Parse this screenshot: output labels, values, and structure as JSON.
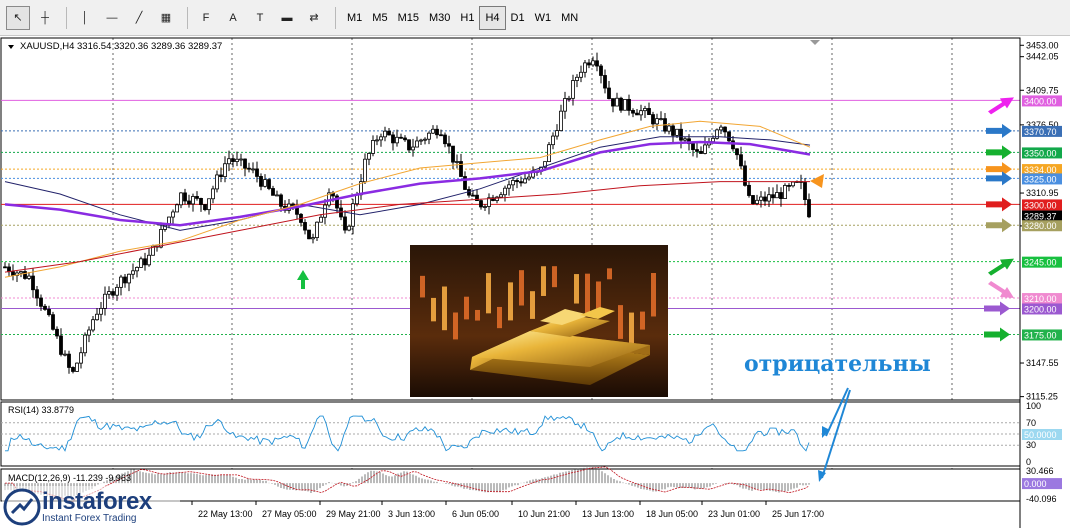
{
  "toolbar": {
    "tools": [
      {
        "name": "cursor-tool",
        "glyph": "↖"
      },
      {
        "name": "crosshair-tool",
        "glyph": "┼"
      },
      {
        "name": "vertical-line-tool",
        "glyph": "│"
      },
      {
        "name": "horizontal-line-tool",
        "glyph": "—"
      },
      {
        "name": "trendline-tool",
        "glyph": "╱"
      },
      {
        "name": "channel-tool",
        "glyph": "▦"
      },
      {
        "name": "fibonacci-tool",
        "glyph": "F"
      },
      {
        "name": "text-tool",
        "glyph": "A"
      },
      {
        "name": "text-label-tool",
        "glyph": "T"
      },
      {
        "name": "rectangle-tool",
        "glyph": "▬"
      },
      {
        "name": "arrows-tool",
        "glyph": "⇄"
      }
    ],
    "timeframes": [
      "M1",
      "M5",
      "M15",
      "M30",
      "H1",
      "H4",
      "D1",
      "W1",
      "MN"
    ],
    "active_timeframe": "H4"
  },
  "header": {
    "symbol": "XAUUSD,H4",
    "ohlc": "3316.54 3320.36 3289.36 3289.37"
  },
  "rsi": {
    "label": "RSI(14) 33.8779",
    "levels": [
      "100",
      "70",
      "50.0000",
      "30",
      "0"
    ]
  },
  "macd": {
    "label": "MACD(12,26,9) -11.239 -9.963",
    "levels": [
      "30.466",
      "0.000",
      "-40.096"
    ]
  },
  "price_axis": {
    "ticks": [
      "3453.00",
      "3442.05",
      "3409.75",
      "3376.50",
      "3310.95",
      "3279.35",
      "3147.55",
      "3115.25"
    ]
  },
  "price_tags": [
    {
      "text": "3400.00",
      "value": 3400,
      "bg": "#e060e0",
      "fg": "#ffffff"
    },
    {
      "text": "3370.70",
      "value": 3370.7,
      "bg": "#3a6fb5",
      "fg": "#ffffff"
    },
    {
      "text": "3350.00",
      "value": 3350,
      "bg": "#12a84a",
      "fg": "#ffffff"
    },
    {
      "text": "3334.00",
      "value": 3334,
      "bg": "#f5a623",
      "fg": "#ffffff"
    },
    {
      "text": "3325.00",
      "value": 3325,
      "bg": "#4a8fe0",
      "fg": "#ffffff"
    },
    {
      "text": "3300.00",
      "value": 3300,
      "bg": "#e01e1e",
      "fg": "#ffffff"
    },
    {
      "text": "3289.37",
      "value": 3289.37,
      "bg": "#000000",
      "fg": "#ffffff"
    },
    {
      "text": "3280.00",
      "value": 3280,
      "bg": "#a6a060",
      "fg": "#ffffff"
    },
    {
      "text": "3245.00",
      "value": 3245,
      "bg": "#18c040",
      "fg": "#ffffff"
    },
    {
      "text": "3210.00",
      "value": 3210,
      "bg": "#f08ad0",
      "fg": "#ffffff"
    },
    {
      "text": "3200.00",
      "value": 3200,
      "bg": "#9b59d0",
      "fg": "#ffffff"
    },
    {
      "text": "3175.00",
      "value": 3175,
      "bg": "#22b24c",
      "fg": "#ffffff"
    }
  ],
  "time_axis": [
    "22 May 13:00",
    "27 May 05:00",
    "29 May 21:00",
    "3 Jun 13:00",
    "6 Jun 05:00",
    "10 Jun 21:00",
    "13 Jun 13:00",
    "18 Jun 05:00",
    "23 Jun 01:00",
    "25 Jun 17:00"
  ],
  "annotation": "отрицательны",
  "logo": {
    "brand": "instaforex",
    "tagline": "Instant Forex Trading"
  },
  "colors": {
    "pink_arrow": "#ee22ee",
    "blue_arrow": "#2a78c8",
    "green_arrow": "#15b02f",
    "orange_arrow": "#f7941d",
    "red_arrow": "#e01e1e",
    "olive_arrow": "#a6a060",
    "violet_arrow": "#9b59d0",
    "light_pink_arrow": "#f08ad0",
    "ma_purple": "#8a2be2",
    "ma_orange": "#f2a633",
    "ma_navy": "#22226a",
    "ma_red": "#c0141e"
  }
}
